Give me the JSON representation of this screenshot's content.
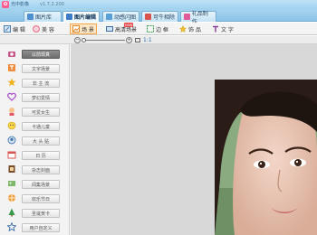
{
  "app": {
    "title": "光中影像",
    "version": "v1.7.2.200"
  },
  "module_tabs": [
    {
      "label": "图片库"
    },
    {
      "label": "图片编辑"
    },
    {
      "label": "动感闪图"
    },
    {
      "label": "可牛相除"
    },
    {
      "label": "礼品制作"
    }
  ],
  "tools": [
    {
      "label": "编 辑"
    },
    {
      "label": "美 容"
    },
    {
      "label": "场 景"
    },
    {
      "label": "高清场景",
      "badge": "new"
    },
    {
      "label": "边 框"
    },
    {
      "label": "饰 品"
    },
    {
      "label": "文 字"
    }
  ],
  "zoom": {
    "ratio_label": "1:1",
    "level": 0.05
  },
  "categories": [
    {
      "label": "以前现真"
    },
    {
      "label": "文字场景"
    },
    {
      "label": "非 主 流"
    },
    {
      "label": "梦幻爱情"
    },
    {
      "label": "可爱女生"
    },
    {
      "label": "卡通儿童"
    },
    {
      "label": "大 头 贴"
    },
    {
      "label": "日 历"
    },
    {
      "label": "杂志封面"
    },
    {
      "label": "闻集场景"
    },
    {
      "label": "欢乐节日"
    },
    {
      "label": "圣诞贺卡"
    },
    {
      "label": "用户自定义"
    }
  ],
  "colors": {
    "accent": "#f0a64e",
    "selected_category": "#6e6e6e",
    "tab_bar": "#8cc3e6"
  }
}
